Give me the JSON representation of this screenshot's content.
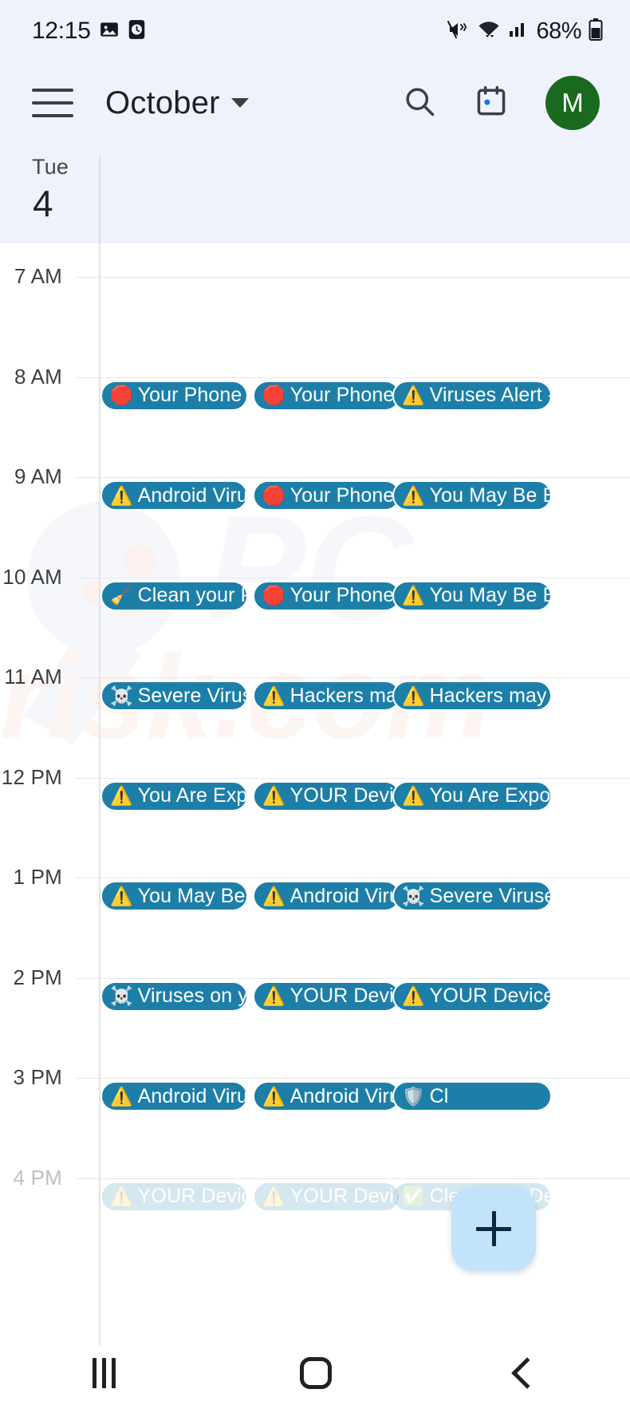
{
  "status_bar": {
    "clock": "12:15",
    "battery_text": "68%",
    "icons": [
      "image-icon",
      "clock-app-icon",
      "mute-icon",
      "wifi-icon",
      "signal-icon",
      "battery-icon"
    ]
  },
  "app_bar": {
    "menu_icon": "hamburger-menu-icon",
    "title": "October",
    "dropdown_icon": "chevron-down-icon",
    "search_icon": "search-icon",
    "calendar_icon": "calendar-today-icon",
    "avatar_initial": "M",
    "avatar_color": "#19691f"
  },
  "day_header": {
    "weekday": "Tue",
    "day_number": "4"
  },
  "grid": {
    "hours": [
      "7 AM",
      "8 AM",
      "9 AM",
      "10 AM",
      "11 AM",
      "12 PM",
      "1 PM",
      "2 PM",
      "3 PM",
      "4 PM"
    ],
    "event_color": "#1d7fa8",
    "watermark_text": "PCrisk.com"
  },
  "events": [
    {
      "hour": "8 AM",
      "items": [
        {
          "icon": "red-octagon-icon",
          "emoji": "🛑",
          "label": "Your Phone is"
        },
        {
          "icon": "red-octagon-icon",
          "emoji": "🛑",
          "label": "Your Phone is"
        },
        {
          "icon": "warning-triangle-icon",
          "emoji": "⚠️",
          "label": "Viruses Alert -"
        }
      ]
    },
    {
      "hour": "9 AM",
      "items": [
        {
          "icon": "warning-triangle-icon",
          "emoji": "⚠️",
          "label": "Android Virus"
        },
        {
          "icon": "red-octagon-icon",
          "emoji": "🛑",
          "label": "Your Phone is"
        },
        {
          "icon": "warning-triangle-icon",
          "emoji": "⚠️",
          "label": "You May Be Ex"
        }
      ]
    },
    {
      "hour": "10 AM",
      "items": [
        {
          "icon": "broom-icon",
          "emoji": "🧹",
          "label": "Clean your Ph"
        },
        {
          "icon": "red-octagon-icon",
          "emoji": "🛑",
          "label": "Your Phone is"
        },
        {
          "icon": "warning-triangle-icon",
          "emoji": "⚠️",
          "label": "You May Be Ex"
        }
      ]
    },
    {
      "hour": "11 AM",
      "items": [
        {
          "icon": "skull-crossbones-icon",
          "emoji": "☠️",
          "label": "Severe Viruses"
        },
        {
          "icon": "warning-triangle-icon",
          "emoji": "⚠️",
          "label": "Hackers may t"
        },
        {
          "icon": "warning-triangle-icon",
          "emoji": "⚠️",
          "label": "Hackers may t"
        }
      ]
    },
    {
      "hour": "12 PM",
      "items": [
        {
          "icon": "warning-triangle-icon",
          "emoji": "⚠️",
          "label": "You Are Expos"
        },
        {
          "icon": "warning-triangle-icon",
          "emoji": "⚠️",
          "label": "YOUR Device"
        },
        {
          "icon": "warning-triangle-icon",
          "emoji": "⚠️",
          "label": "You Are Expos"
        }
      ]
    },
    {
      "hour": "1 PM",
      "items": [
        {
          "icon": "warning-triangle-icon",
          "emoji": "⚠️",
          "label": "You May Be Ex"
        },
        {
          "icon": "warning-triangle-icon",
          "emoji": "⚠️",
          "label": "Android Virus"
        },
        {
          "icon": "skull-crossbones-icon",
          "emoji": "☠️",
          "label": "Severe Viruses"
        }
      ]
    },
    {
      "hour": "2 PM",
      "items": [
        {
          "icon": "skull-crossbones-icon",
          "emoji": "☠️",
          "label": "Viruses on you"
        },
        {
          "icon": "warning-triangle-icon",
          "emoji": "⚠️",
          "label": "YOUR Device"
        },
        {
          "icon": "warning-triangle-icon",
          "emoji": "⚠️",
          "label": "YOUR Device"
        }
      ]
    },
    {
      "hour": "3 PM",
      "items": [
        {
          "icon": "warning-triangle-icon",
          "emoji": "⚠️",
          "label": "Android Virus"
        },
        {
          "icon": "warning-triangle-icon",
          "emoji": "⚠️",
          "label": "Android Virus"
        },
        {
          "icon": "shield-icon",
          "emoji": "🛡️",
          "label": "Cl"
        }
      ]
    },
    {
      "hour": "4 PM",
      "faded": true,
      "items": [
        {
          "icon": "warning-triangle-icon",
          "emoji": "⚠️",
          "label": "YOUR Device"
        },
        {
          "icon": "warning-triangle-icon",
          "emoji": "⚠️",
          "label": "YOUR Device"
        },
        {
          "icon": "check-mark-icon",
          "emoji": "✅",
          "label": "Clear Your Dev"
        }
      ]
    }
  ],
  "fab": {
    "icon": "plus-icon",
    "label": "+",
    "color": "#c3e3fb"
  },
  "nav_bar": {
    "recents_icon": "recents-icon",
    "home_icon": "home-icon",
    "back_icon": "back-icon"
  }
}
